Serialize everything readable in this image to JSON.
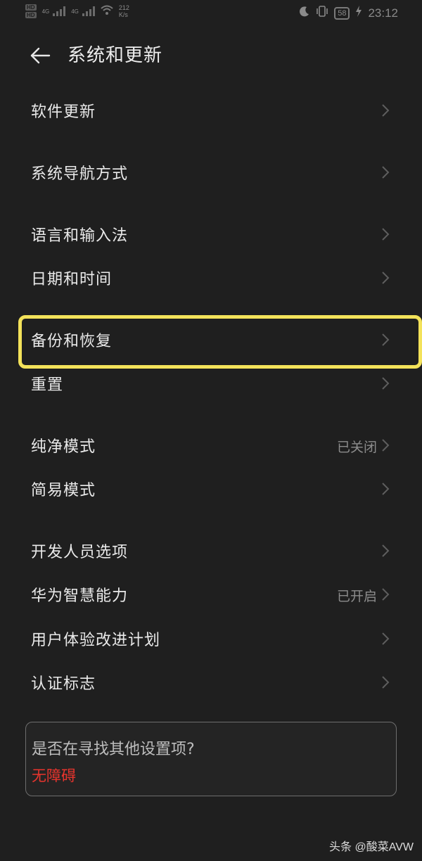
{
  "status_bar": {
    "hd1": "HD",
    "hd2": "HD",
    "sim1_tag": "4G",
    "sim2_tag": "4G",
    "wifi_icon": "wifi-icon",
    "speed_value": "212",
    "speed_unit": "K/s",
    "moon_icon": "moon-icon",
    "vibrate_icon": "vibrate-icon",
    "battery": "58",
    "time": "23:12"
  },
  "header": {
    "title": "系统和更新",
    "back_icon": "back-arrow-icon"
  },
  "menu": {
    "items": [
      {
        "label": "软件更新",
        "status": ""
      },
      {
        "label": "系统导航方式",
        "status": ""
      },
      {
        "label": "语言和输入法",
        "status": ""
      },
      {
        "label": "日期和时间",
        "status": ""
      },
      {
        "label": "备份和恢复",
        "status": ""
      },
      {
        "label": "重置",
        "status": ""
      },
      {
        "label": "纯净模式",
        "status": "已关闭"
      },
      {
        "label": "简易模式",
        "status": ""
      },
      {
        "label": "开发人员选项",
        "status": ""
      },
      {
        "label": "华为智慧能力",
        "status": "已开启"
      },
      {
        "label": "用户体验改进计划",
        "status": ""
      },
      {
        "label": "认证标志",
        "status": ""
      }
    ]
  },
  "suggestion": {
    "title": "是否在寻找其他设置项?",
    "link": "无障碍"
  },
  "watermark": "头条 @酸菜AVW",
  "colors": {
    "background": "#1f1f1f",
    "highlight": "#f3e25a",
    "link_red": "#e8342d"
  }
}
